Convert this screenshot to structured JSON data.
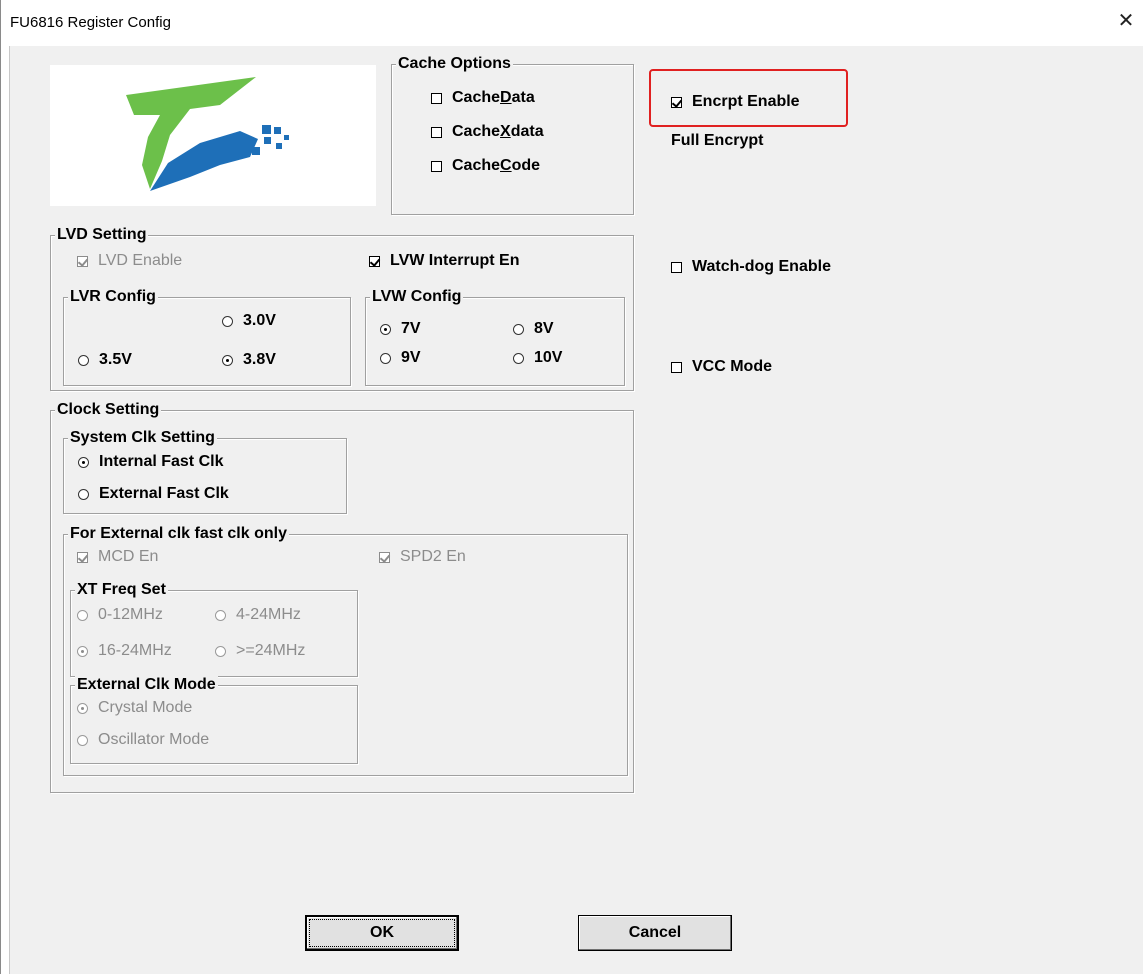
{
  "window": {
    "title": "FU6816 Register Config",
    "close_glyph": "✕"
  },
  "logo": {
    "name": "fortior-logo",
    "green": "#6cc04a",
    "blue": "#1e6fb8"
  },
  "cache_options": {
    "label": "Cache Options",
    "items": [
      {
        "pre": "Cache ",
        "key": "D",
        "post": "ata",
        "checked": false
      },
      {
        "pre": "Cache ",
        "key": "X",
        "post": "data",
        "checked": false
      },
      {
        "pre": "Cache ",
        "key": "C",
        "post": "ode",
        "checked": false
      }
    ]
  },
  "encrypt": {
    "label": "Encrpt Enable",
    "checked": true,
    "mode": "Full Encrypt",
    "highlight_color": "#e02020"
  },
  "watchdog": {
    "label": "Watch-dog Enable",
    "checked": false
  },
  "vcc": {
    "label": "VCC Mode",
    "checked": false
  },
  "lvd": {
    "label": "LVD Setting",
    "lvd_enable": {
      "label": "LVD Enable",
      "checked": true,
      "disabled": true
    },
    "lvw_interrupt": {
      "label": "LVW Interrupt En",
      "checked": true
    },
    "lvr": {
      "label": "LVR Config",
      "opt_30": "3.0V",
      "opt_35": "3.5V",
      "opt_38": "3.8V",
      "selected": "3.8V"
    },
    "lvw": {
      "label": "LVW Config",
      "opt_7": "7V",
      "opt_8": "8V",
      "opt_9": "9V",
      "opt_10": "10V",
      "selected": "7V"
    }
  },
  "clock": {
    "label": "Clock Setting",
    "system": {
      "label": "System Clk Setting",
      "internal": "Internal Fast Clk",
      "external": "External Fast Clk",
      "selected": "Internal Fast Clk"
    },
    "external_only": {
      "label": "For External clk fast clk only",
      "mcd": {
        "label": "MCD En",
        "checked": true
      },
      "spd2": {
        "label": "SPD2 En",
        "checked": true
      },
      "xt_freq": {
        "label": "XT Freq Set",
        "opt_a": "0-12MHz",
        "opt_b": "4-24MHz",
        "opt_c": "16-24MHz",
        "opt_d": ">=24MHz",
        "selected": "16-24MHz"
      },
      "ext_mode": {
        "label": "External Clk Mode",
        "crystal": "Crystal Mode",
        "oscillator": "Oscillator Mode",
        "selected": "Crystal Mode"
      }
    }
  },
  "buttons": {
    "ok": "OK",
    "cancel": "Cancel"
  }
}
